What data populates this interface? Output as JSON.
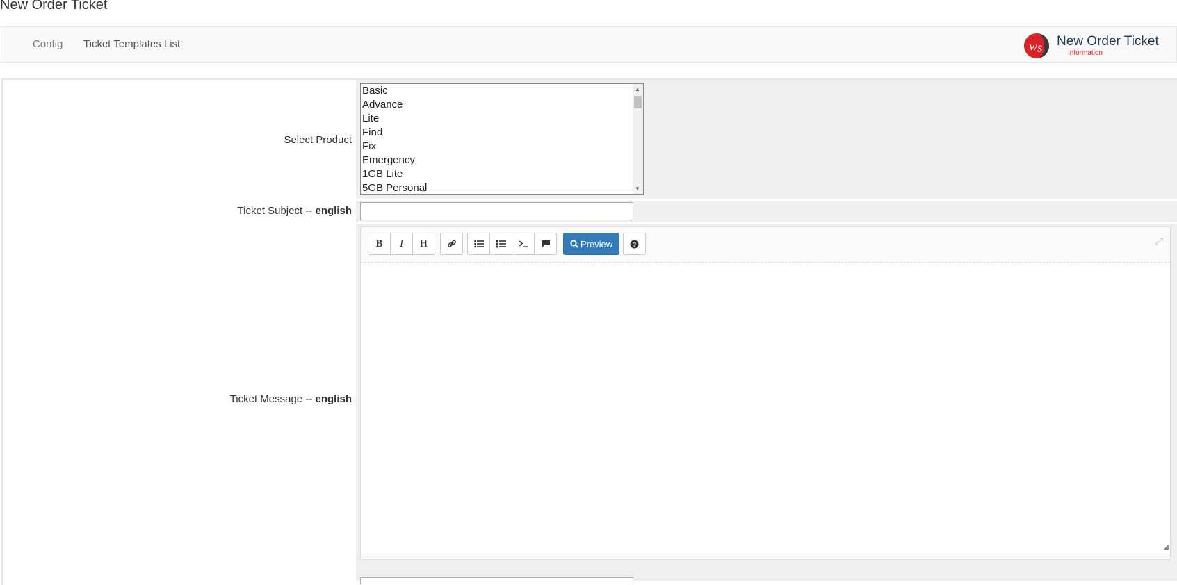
{
  "page": {
    "title": "New Order Ticket"
  },
  "nav": {
    "links": [
      {
        "label": "Config"
      },
      {
        "label": "Ticket Templates List"
      }
    ],
    "logo": {
      "title": "New Order Ticket",
      "subtitle": "Information",
      "brand_color": "#d9232a"
    }
  },
  "form": {
    "select_product": {
      "label": "Select Product",
      "options": [
        "Basic",
        "Advance",
        "Lite",
        "Find",
        "Fix",
        "Emergency",
        "1GB Lite",
        "5GB Personal"
      ]
    },
    "ticket_subject": {
      "label": "Ticket Subject -- ",
      "lang": "english",
      "value": ""
    },
    "ticket_message": {
      "label": "Ticket Message -- ",
      "lang": "english",
      "value": ""
    },
    "editor": {
      "preview_label": "Preview",
      "preview_color": "#337ab7",
      "icons": [
        "bold-icon",
        "italic-icon",
        "heading-icon",
        "link-icon",
        "unordered-list-icon",
        "ordered-list-icon",
        "code-icon",
        "quote-icon",
        "search-icon",
        "help-icon",
        "fullscreen-icon"
      ]
    }
  }
}
